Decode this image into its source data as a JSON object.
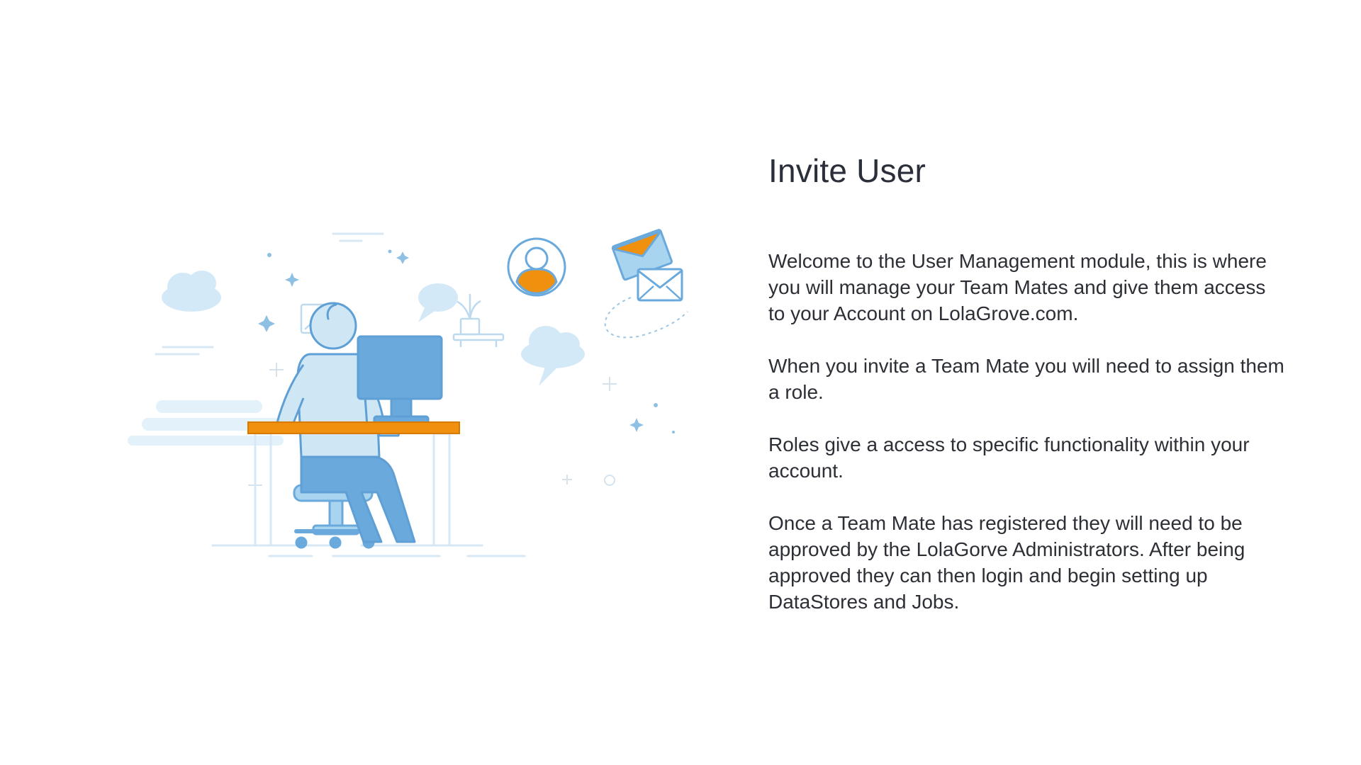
{
  "page": {
    "title": "Invite User",
    "paragraphs": [
      "Welcome to the User Management module, this is where you will manage your Team Mates and give them access to your Account on LolaGrove.com.",
      "When you invite a Team Mate you will need to assign them a role.",
      "Roles give a access to specific functionality within your account.",
      "Once a Team Mate has registered they will need to be approved by the LolaGorve Administrators. After being approved they can then login and begin setting up DataStores and Jobs."
    ]
  },
  "illustration": {
    "icons": [
      "person-at-desk-icon",
      "computer-monitor-icon",
      "user-avatar-icon",
      "envelope-icon",
      "cloud-icon",
      "chat-bubble-icon",
      "picture-frame-icon",
      "plant-icon",
      "sparkle-icon"
    ]
  },
  "colors": {
    "accent_orange": "#f0900f",
    "primary_blue": "#6aa9dc",
    "light_blue": "#cfe6f5",
    "outline_blue": "#7cb3db",
    "text_dark": "#2d2f36"
  }
}
